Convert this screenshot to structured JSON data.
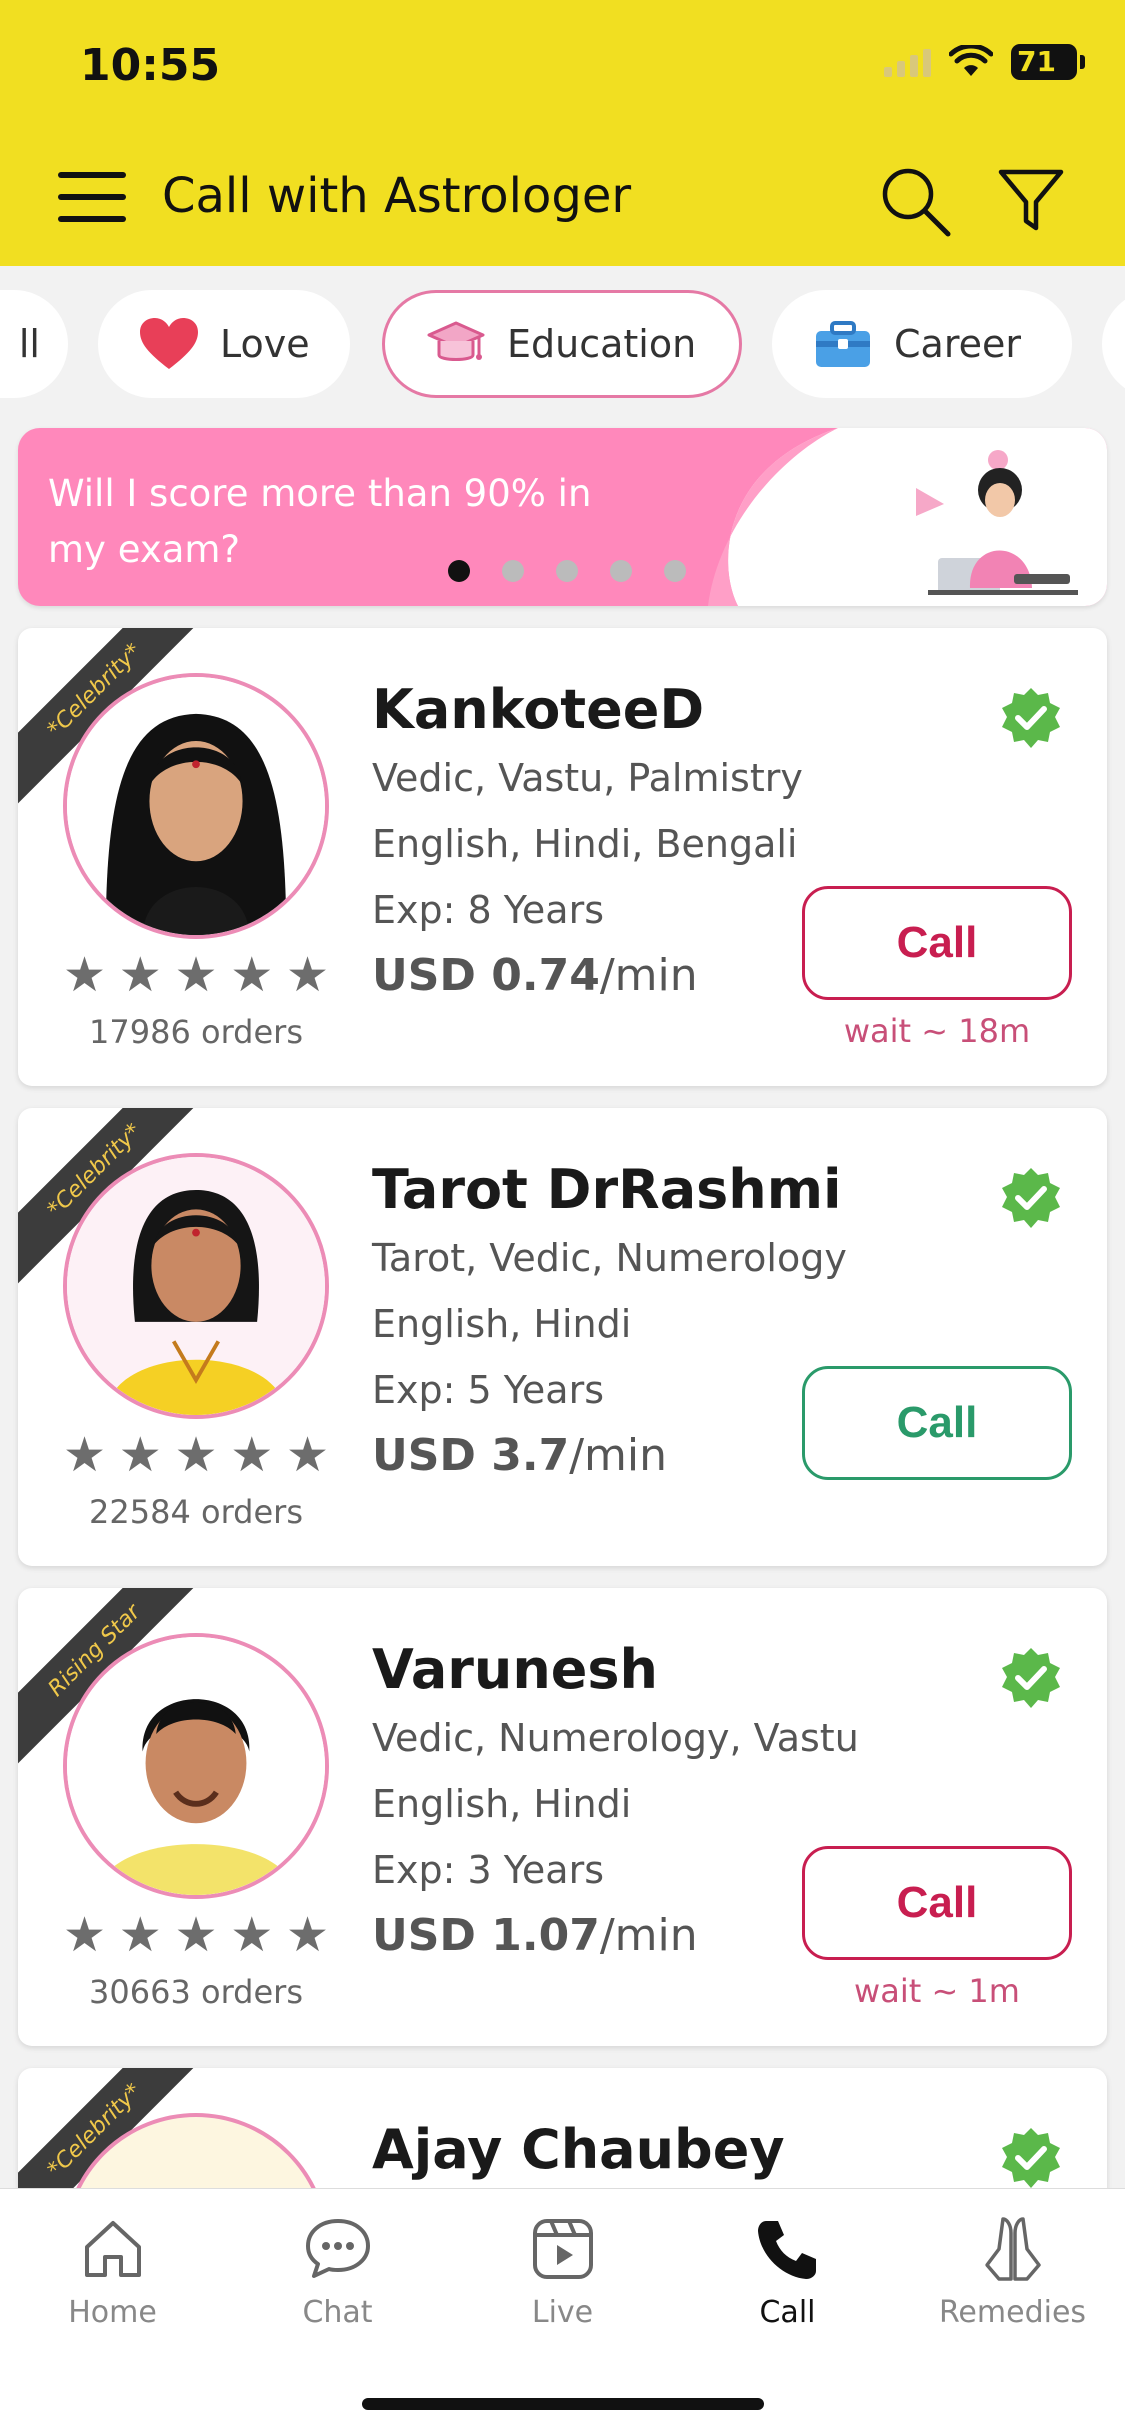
{
  "status_bar": {
    "time": "10:55",
    "battery": "71"
  },
  "header": {
    "title": "Call with Astrologer",
    "menu_icon": "hamburger-icon",
    "search_icon": "search-icon",
    "filter_icon": "filter-icon"
  },
  "categories": [
    {
      "label": "ll",
      "icon": ""
    },
    {
      "label": "Love",
      "icon": "heart-icon"
    },
    {
      "label": "Education",
      "icon": "graduation-cap-icon",
      "active": true
    },
    {
      "label": "Career",
      "icon": "briefcase-icon"
    }
  ],
  "banner": {
    "text": "Will I score more than 90% in my exam?",
    "slide_count": 5,
    "active_slide": 1
  },
  "astrologers": [
    {
      "badge": "*Celebrity*",
      "name": "KankoteeD",
      "skills": "Vedic,  Vastu,  Palmistry",
      "languages": "English, Hindi, Bengali",
      "experience": "Exp: 8 Years",
      "price_value": "USD 0.74",
      "price_unit": "/min",
      "rating": 5,
      "orders": "17986 orders",
      "call_label": "Call",
      "call_state": "busy",
      "wait": "wait ~ 18m"
    },
    {
      "badge": "*Celebrity*",
      "name": "Tarot DrRashmi",
      "skills": "Tarot,  Vedic,  Numerology",
      "languages": "English, Hindi",
      "experience": "Exp: 5 Years",
      "price_value": "USD 3.7",
      "price_unit": "/min",
      "rating": 5,
      "orders": "22584 orders",
      "call_label": "Call",
      "call_state": "available",
      "wait": ""
    },
    {
      "badge": "Rising Star",
      "name": "Varunesh",
      "skills": "Vedic,  Numerology,  Vastu",
      "languages": "English, Hindi",
      "experience": "Exp: 3 Years",
      "price_value": "USD 1.07",
      "price_unit": "/min",
      "rating": 5,
      "orders": "30663 orders",
      "call_label": "Call",
      "call_state": "busy",
      "wait": "wait ~ 1m"
    },
    {
      "badge": "*Celebrity*",
      "name": "Ajay Chaubey"
    }
  ],
  "bottom_nav": [
    {
      "label": "Home",
      "icon": "home-icon"
    },
    {
      "label": "Chat",
      "icon": "chat-icon"
    },
    {
      "label": "Live",
      "icon": "live-icon"
    },
    {
      "label": "Call",
      "icon": "phone-icon",
      "active": true
    },
    {
      "label": "Remedies",
      "icon": "praying-hands-icon"
    }
  ],
  "colors": {
    "header_bg": "#f1df21",
    "accent_pink": "#e579a5",
    "busy_red": "#c81e50",
    "available_green": "#2a9a6a",
    "verified_green": "#5bb84a"
  }
}
